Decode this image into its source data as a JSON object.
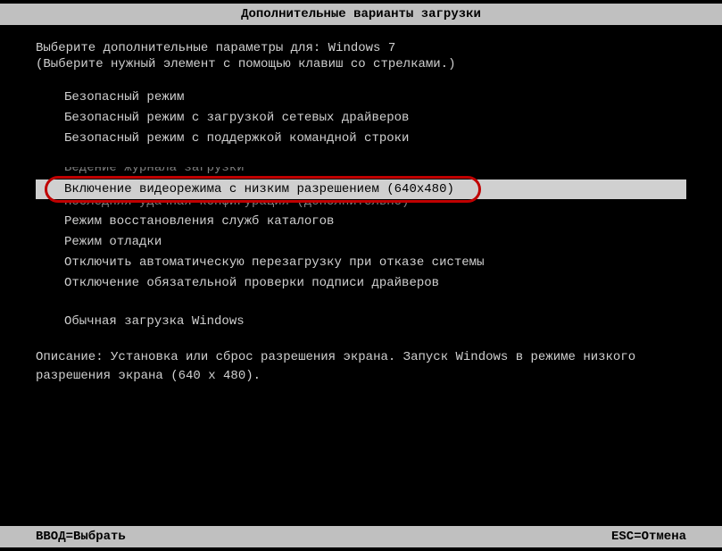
{
  "header": {
    "title": "Дополнительные варианты загрузки"
  },
  "prompt": {
    "line1": "Выберите дополнительные параметры для: Windows 7",
    "line2": "(Выберите нужный элемент с помощью клавиш со стрелками.)"
  },
  "menu": {
    "group1": [
      "Безопасный режим",
      "Безопасный режим с загрузкой сетевых драйверов",
      "Безопасный режим с поддержкой командной строки"
    ],
    "partial_above": "Ведение журнала загрузки",
    "selected": "Включение видеорежима с низким разрешением (640x480)",
    "partial_below": "Последняя удачная конфигурация (дополнительно)",
    "group2": [
      "Режим восстановления служб каталогов",
      "Режим отладки",
      "Отключить автоматическую перезагрузку при отказе системы",
      "Отключение обязательной проверки подписи драйверов"
    ],
    "group3": [
      "Обычная загрузка Windows"
    ]
  },
  "description": {
    "label": "Описание:",
    "text": "Установка или сброс разрешения экрана. Запуск Windows в режиме низкого разрешения экрана (640 x 480)."
  },
  "footer": {
    "left": "ВВОД=Выбрать",
    "right": "ESC=Отмена"
  }
}
